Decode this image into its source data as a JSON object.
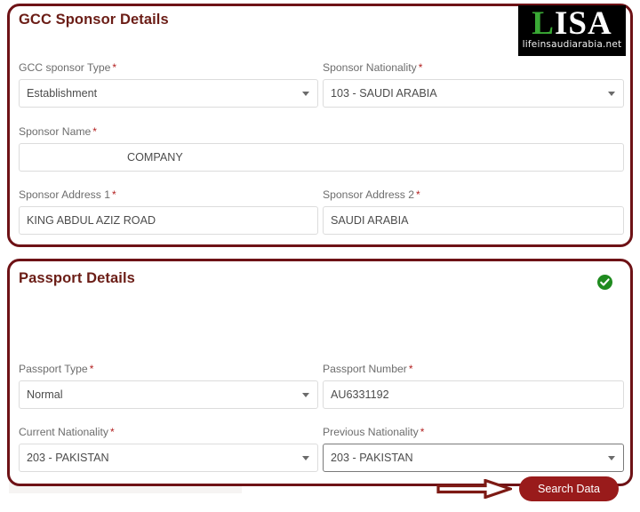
{
  "logo": {
    "name": "LISA",
    "first_letter": "L",
    "rest_letters": "ISA",
    "subtitle": "lifeinsaudiarabia.net",
    "green": "#3aa935"
  },
  "theme": {
    "card_border": "#6e1216",
    "title_color": "#6b1d16",
    "accent_button": "#991b1b",
    "required_star": "#b32121",
    "success_green": "#1f8b1f"
  },
  "sponsor_card": {
    "title": "GCC Sponsor Details",
    "fields": {
      "sponsor_type": {
        "label": "GCC sponsor Type",
        "required": "*",
        "value": "Establishment",
        "type": "select"
      },
      "sponsor_nationality": {
        "label": "Sponsor Nationality",
        "required": "*",
        "value": "103 - SAUDI ARABIA",
        "type": "select"
      },
      "sponsor_name": {
        "label": "Sponsor Name",
        "required": "*",
        "value": "COMPANY",
        "type": "text"
      },
      "sponsor_address_1": {
        "label": "Sponsor Address 1",
        "required": "*",
        "value": "KING ABDUL AZIZ ROAD",
        "type": "text"
      },
      "sponsor_address_2": {
        "label": "Sponsor Address 2",
        "required": "*",
        "value": "SAUDI ARABIA",
        "type": "text"
      }
    }
  },
  "passport_card": {
    "title": "Passport Details",
    "status_icon": "check-circle-icon",
    "fields": {
      "passport_type": {
        "label": "Passport Type",
        "required": "*",
        "value": "Normal",
        "type": "select"
      },
      "passport_number": {
        "label": "Passport Number",
        "required": "*",
        "value": "AU6331192",
        "type": "text"
      },
      "current_nationality": {
        "label": "Current Nationality",
        "required": "*",
        "value": "203 - PAKISTAN",
        "type": "select"
      },
      "previous_nationality": {
        "label": "Previous Nationality",
        "required": "*",
        "value": "203 - PAKISTAN",
        "type": "select"
      }
    },
    "search_button": {
      "label": "Search Data"
    },
    "annotation_icon": "right-arrow-annotation-icon"
  }
}
